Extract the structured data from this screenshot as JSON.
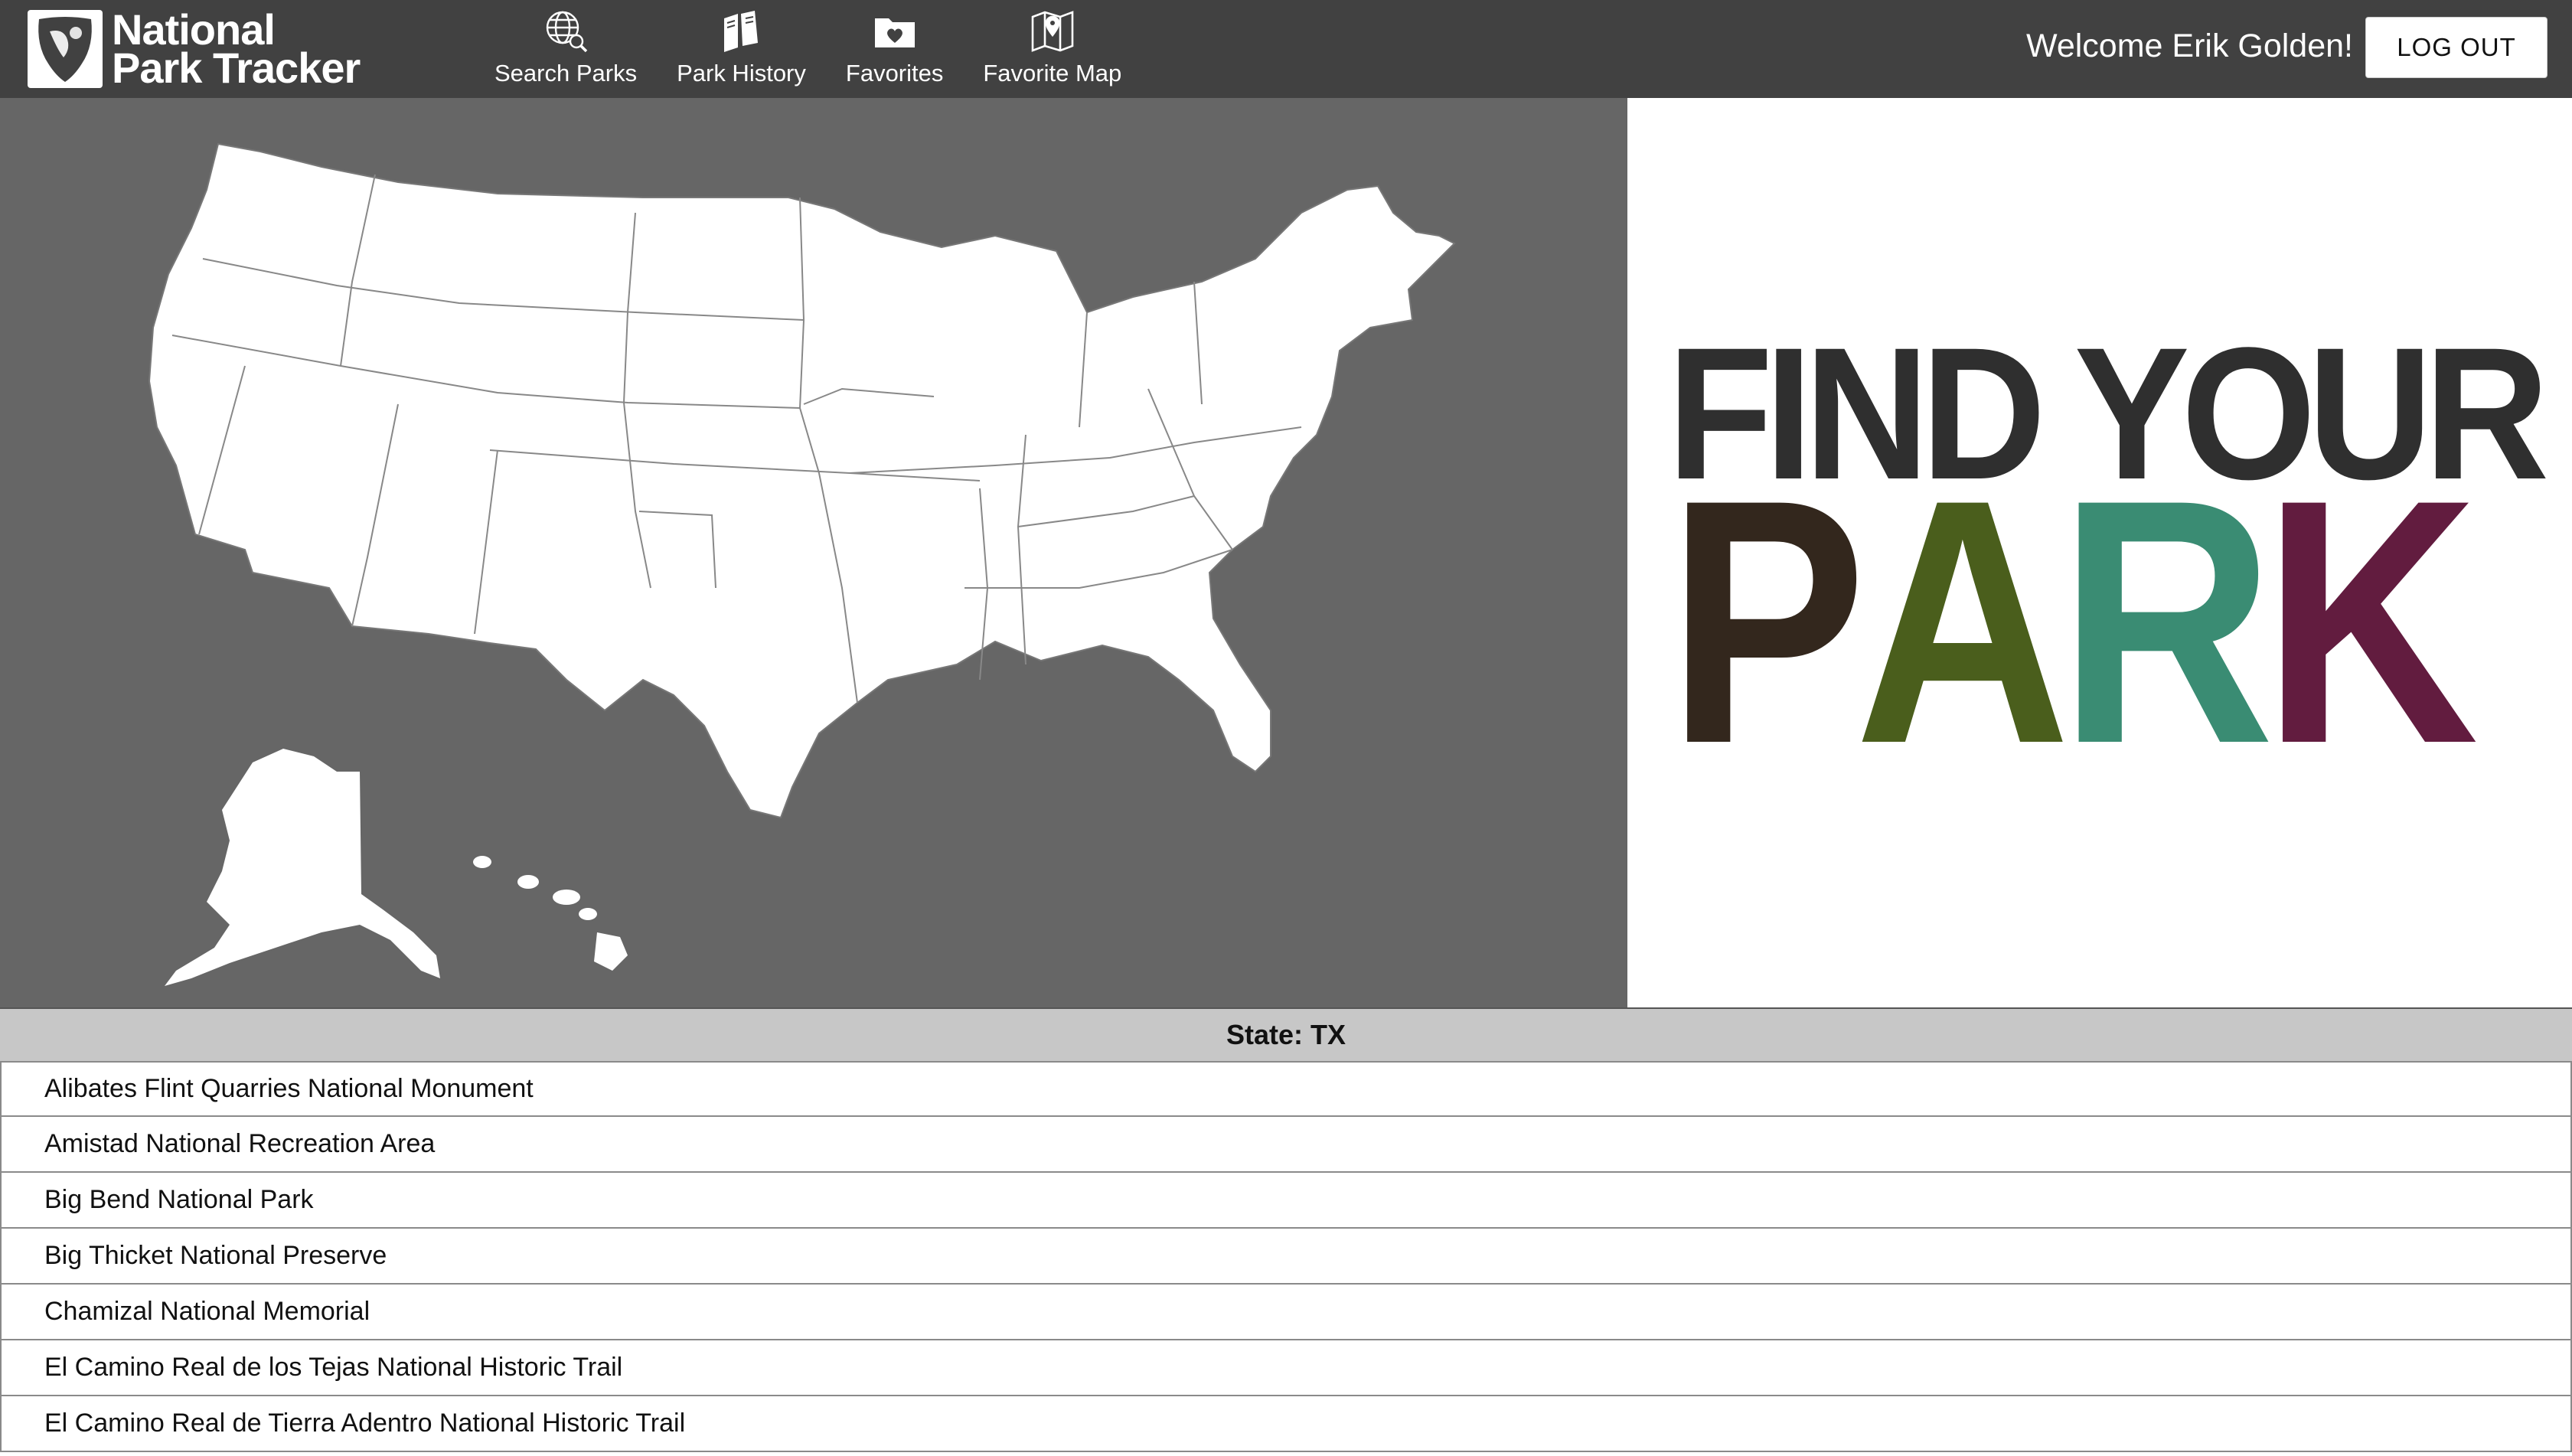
{
  "brand": {
    "line1": "National",
    "line2": "Park Tracker",
    "logo_icon": "arrowhead-icon"
  },
  "nav": [
    {
      "label": "Search Parks",
      "icon": "globe-search-icon"
    },
    {
      "label": "Park History",
      "icon": "books-icon"
    },
    {
      "label": "Favorites",
      "icon": "heart-folder-icon"
    },
    {
      "label": "Favorite Map",
      "icon": "map-pin-icon"
    }
  ],
  "user": {
    "welcome": "Welcome Erik Golden!",
    "logout_label": "LOG OUT"
  },
  "hero": {
    "line1": "FIND YOUR",
    "letters": [
      "P",
      "A",
      "R",
      "K"
    ],
    "colors": {
      "P": "#33271d",
      "A": "#4a5e1c",
      "R": "#3a8c73",
      "K": "#621c3f"
    }
  },
  "colors": {
    "header": "#414141",
    "map_bg": "#666666",
    "state_bar": "#c7c7c7"
  },
  "state": {
    "label": "State: TX"
  },
  "parks": [
    "Alibates Flint Quarries National Monument",
    "Amistad National Recreation Area",
    "Big Bend National Park",
    "Big Thicket National Preserve",
    "Chamizal National Memorial",
    "El Camino Real de los Tejas National Historic Trail",
    "El Camino Real de Tierra Adentro National Historic Trail"
  ]
}
